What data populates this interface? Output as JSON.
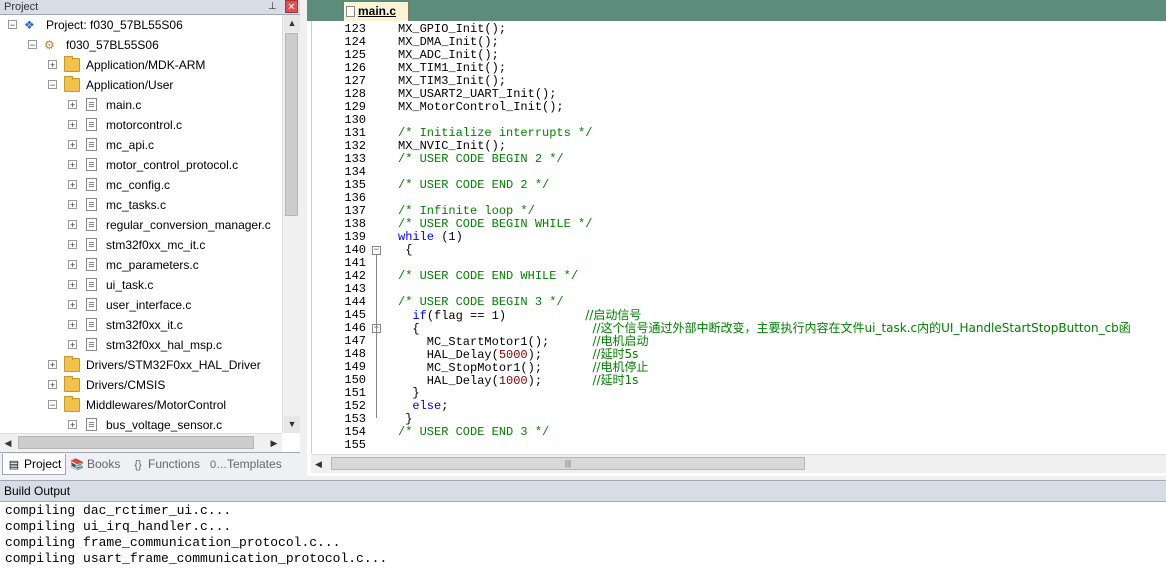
{
  "project_pane": {
    "title": "Project",
    "tree": [
      {
        "label": "Project: f030_57BL55S06",
        "kind": "project",
        "expanded": true
      },
      {
        "label": "f030_57BL55S06",
        "kind": "target",
        "expanded": true
      },
      {
        "label": "Application/MDK-ARM",
        "kind": "folder",
        "expanded": false
      },
      {
        "label": "Application/User",
        "kind": "folder",
        "expanded": true
      },
      {
        "label": "main.c",
        "kind": "file"
      },
      {
        "label": "motorcontrol.c",
        "kind": "file"
      },
      {
        "label": "mc_api.c",
        "kind": "file"
      },
      {
        "label": "motor_control_protocol.c",
        "kind": "file"
      },
      {
        "label": "mc_config.c",
        "kind": "file"
      },
      {
        "label": "mc_tasks.c",
        "kind": "file"
      },
      {
        "label": "regular_conversion_manager.c",
        "kind": "file"
      },
      {
        "label": "stm32f0xx_mc_it.c",
        "kind": "file"
      },
      {
        "label": "mc_parameters.c",
        "kind": "file"
      },
      {
        "label": "ui_task.c",
        "kind": "file"
      },
      {
        "label": "user_interface.c",
        "kind": "file"
      },
      {
        "label": "stm32f0xx_it.c",
        "kind": "file"
      },
      {
        "label": "stm32f0xx_hal_msp.c",
        "kind": "file"
      },
      {
        "label": "Drivers/STM32F0xx_HAL_Driver",
        "kind": "folder",
        "expanded": false
      },
      {
        "label": "Drivers/CMSIS",
        "kind": "folder",
        "expanded": false
      },
      {
        "label": "Middlewares/MotorControl",
        "kind": "folder",
        "expanded": true
      },
      {
        "label": "bus_voltage_sensor.c",
        "kind": "file"
      }
    ],
    "tabs": [
      {
        "label": "Project",
        "icon": "project-icon",
        "active": true
      },
      {
        "label": "Books",
        "icon": "books-icon",
        "active": false
      },
      {
        "label": "Functions",
        "icon": "braces-icon",
        "active": false
      },
      {
        "label": "Templates",
        "icon": "templates-icon",
        "active": false
      }
    ]
  },
  "editor": {
    "tab_label": "main.c",
    "lines": [
      {
        "n": "123",
        "code": [
          [
            "t",
            "MX_GPIO_Init();"
          ]
        ]
      },
      {
        "n": "124",
        "code": [
          [
            "t",
            "MX_DMA_Init();"
          ]
        ]
      },
      {
        "n": "125",
        "code": [
          [
            "t",
            "MX_ADC_Init();"
          ]
        ]
      },
      {
        "n": "126",
        "code": [
          [
            "t",
            "MX_TIM1_Init();"
          ]
        ]
      },
      {
        "n": "127",
        "code": [
          [
            "t",
            "MX_TIM3_Init();"
          ]
        ]
      },
      {
        "n": "128",
        "code": [
          [
            "t",
            "MX_USART2_UART_Init();"
          ]
        ]
      },
      {
        "n": "129",
        "code": [
          [
            "t",
            "MX_MotorControl_Init();"
          ]
        ]
      },
      {
        "n": "130",
        "code": []
      },
      {
        "n": "131",
        "code": [
          [
            "c",
            "/* Initialize interrupts */"
          ]
        ]
      },
      {
        "n": "132",
        "code": [
          [
            "t",
            "MX_NVIC_Init();"
          ]
        ]
      },
      {
        "n": "133",
        "code": [
          [
            "c",
            "/* USER CODE BEGIN 2 */"
          ]
        ]
      },
      {
        "n": "134",
        "code": []
      },
      {
        "n": "135",
        "code": [
          [
            "c",
            "/* USER CODE END 2 */"
          ]
        ]
      },
      {
        "n": "136",
        "code": []
      },
      {
        "n": "137",
        "code": [
          [
            "c",
            "/* Infinite loop */"
          ]
        ]
      },
      {
        "n": "138",
        "code": [
          [
            "c",
            "/* USER CODE BEGIN WHILE */"
          ]
        ]
      },
      {
        "n": "139",
        "code": [
          [
            "k",
            "while"
          ],
          [
            "t",
            " (1)"
          ]
        ]
      },
      {
        "n": "140",
        "code": [
          [
            "t",
            " {"
          ]
        ],
        "fold": true
      },
      {
        "n": "141",
        "code": []
      },
      {
        "n": "142",
        "code": [
          [
            "c",
            "/* USER CODE END WHILE */"
          ]
        ]
      },
      {
        "n": "143",
        "code": []
      },
      {
        "n": "144",
        "code": [
          [
            "c",
            "/* USER CODE BEGIN 3 */"
          ]
        ]
      },
      {
        "n": "145",
        "code": [
          [
            "t",
            "  "
          ],
          [
            "k",
            "if"
          ],
          [
            "t",
            "(flag == 1)           "
          ],
          [
            "z",
            "//启动信号"
          ]
        ]
      },
      {
        "n": "146",
        "code": [
          [
            "t",
            "  {                        "
          ],
          [
            "z",
            "//这个信号通过外部中断改变，主要执行内容在文件ui_task.c内的UI_HandleStartStopButton_cb函"
          ]
        ],
        "fold": true
      },
      {
        "n": "147",
        "code": [
          [
            "t",
            "    MC_StartMotor1();      "
          ],
          [
            "z",
            "//电机启动"
          ]
        ]
      },
      {
        "n": "148",
        "code": [
          [
            "t",
            "    HAL_Delay("
          ],
          [
            "n",
            "5000"
          ],
          [
            "t",
            ");       "
          ],
          [
            "z",
            "//延时5s"
          ]
        ]
      },
      {
        "n": "149",
        "code": [
          [
            "t",
            "    MC_StopMotor1();       "
          ],
          [
            "z",
            "//电机停止"
          ]
        ]
      },
      {
        "n": "150",
        "code": [
          [
            "t",
            "    HAL_Delay("
          ],
          [
            "n",
            "1000"
          ],
          [
            "t",
            ");       "
          ],
          [
            "z",
            "//延时1s"
          ]
        ]
      },
      {
        "n": "151",
        "code": [
          [
            "t",
            "  }"
          ]
        ]
      },
      {
        "n": "152",
        "code": [
          [
            "t",
            "  "
          ],
          [
            "k",
            "else"
          ],
          [
            "t",
            ";"
          ]
        ]
      },
      {
        "n": "153",
        "code": [
          [
            "t",
            " }"
          ]
        ]
      },
      {
        "n": "154",
        "code": [
          [
            "c",
            "/* USER CODE END 3 */"
          ]
        ]
      },
      {
        "n": "155",
        "code": []
      }
    ]
  },
  "build_output": {
    "title": "Build Output",
    "lines": [
      "compiling dac_rctimer_ui.c...",
      "compiling ui_irq_handler.c...",
      "compiling frame_communication_protocol.c...",
      "compiling usart_frame_communication_protocol.c..."
    ]
  }
}
